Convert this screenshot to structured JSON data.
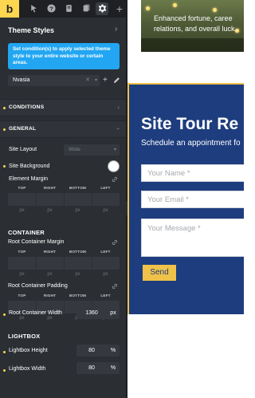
{
  "toolbar": {
    "logo": "b",
    "items": [
      "pointer-icon",
      "help-icon",
      "pages-icon",
      "settings-icon",
      "add-icon"
    ],
    "plus": "+"
  },
  "panel": {
    "title": "Theme Styles",
    "close": "›",
    "info": "Set condition(s) to apply selected theme style to your entire website or certain areas.",
    "style_select": {
      "value": "Nvasia",
      "clear": "✕",
      "caret": "▾"
    },
    "add": "+",
    "sections": {
      "conditions": "CONDITIONS",
      "general": "GENERAL"
    },
    "general": {
      "site_layout_label": "Site Layout",
      "site_layout_value": "Wide",
      "site_background_label": "Site Background",
      "element_margin_label": "Element Margin"
    },
    "margin_heads": [
      "TOP",
      "RIGHT",
      "BOTTOM",
      "LEFT"
    ],
    "unit": "px",
    "container": {
      "heading": "CONTAINER",
      "root_margin_label": "Root Container Margin",
      "root_padding_label": "Root Container Padding",
      "root_width_label": "Root Container Width",
      "root_width_value": "1360",
      "root_width_unit": "px"
    },
    "lightbox": {
      "heading": "LIGHTBOX",
      "height_label": "Lightbox Height",
      "height_value": "80",
      "height_unit": "%",
      "width_label": "Lightbox Width",
      "width_value": "80",
      "width_unit": "%"
    }
  },
  "preview": {
    "hero_line1": "Enhanced fortune, caree",
    "hero_line2": "relations, and overall luck.",
    "tour_title": "Site Tour Re",
    "tour_subtitle": "Schedule an appointment fo",
    "name_placeholder": "Your Name *",
    "email_placeholder": "Your Email *",
    "message_placeholder": "Your Message *",
    "send_label": "Send"
  },
  "colors": {
    "panel_bg": "#2b2e33",
    "accent_yellow": "#ffd64f",
    "info_blue": "#22a6f2",
    "tour_blue": "#1e3d7e",
    "send_yellow": "#f0c24a"
  }
}
